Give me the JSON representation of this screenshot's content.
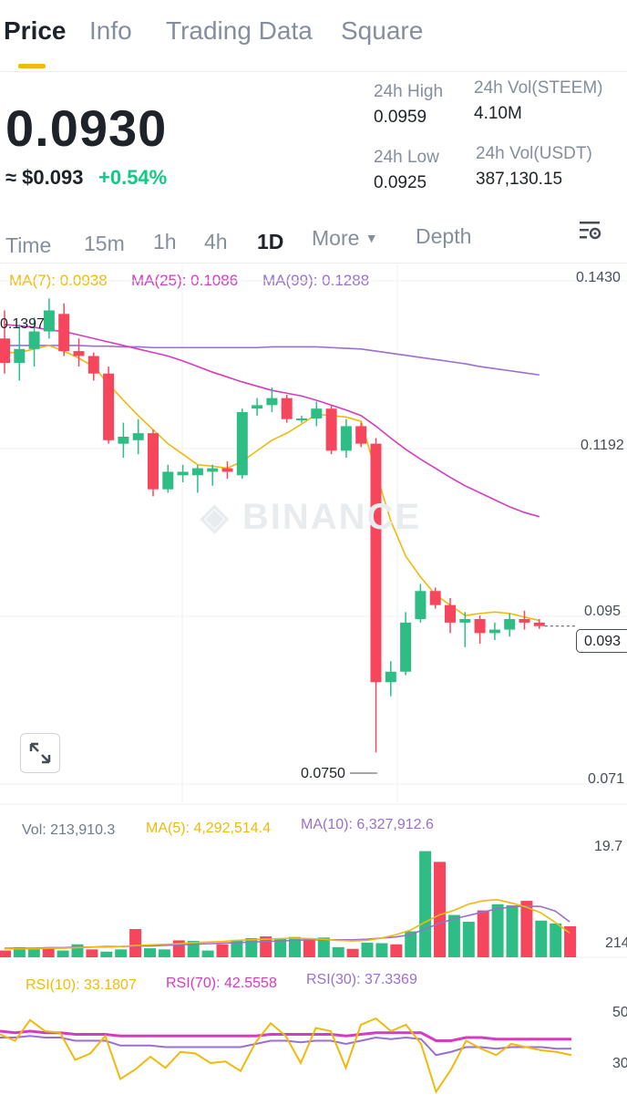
{
  "tabs": [
    "Price",
    "Info",
    "Trading Data",
    "Square"
  ],
  "price": {
    "last": "0.0930",
    "usd": "≈ $0.093",
    "change": "+0.54%"
  },
  "stats": {
    "high_label": "24h High",
    "high_value": "0.0959",
    "low_label": "24h Low",
    "low_value": "0.0925",
    "vol_base_label": "24h Vol(STEEM)",
    "vol_base_value": "4.10M",
    "vol_quote_label": "24h Vol(USDT)",
    "vol_quote_value": "387,130.15"
  },
  "timeframes": [
    "Time",
    "15m",
    "1h",
    "4h",
    "1D",
    "More",
    "Depth"
  ],
  "active_timeframe": "1D",
  "ma_legend": {
    "ma7": "MA(7): 0.0938",
    "ma25": "MA(25): 0.1086",
    "ma99": "MA(99): 0.1288"
  },
  "price_axis": [
    "0.1430",
    "0.1192",
    "0.095",
    "0.071"
  ],
  "current_price_tag": "0.093",
  "marker_high": "0.1397",
  "marker_low": "0.0750",
  "watermark": "BINANCE",
  "volume_legend": {
    "vol": "Vol: 213,910.3",
    "ma5": "MA(5): 4,292,514.4",
    "ma10": "MA(10): 6,327,912.6"
  },
  "volume_axis": [
    "19.7",
    "214"
  ],
  "rsi_legend": {
    "rsi10": "RSI(10): 33.1807",
    "rsi70": "RSI(70): 42.5558",
    "rsi30": "RSI(30): 37.3369"
  },
  "rsi_axis": [
    "50",
    "30"
  ],
  "colors": {
    "up": "#2ebd85",
    "down": "#f6465d",
    "ma7": "#f0b90b",
    "ma25": "#d63bc1",
    "ma99": "#9a6fcf",
    "accent": "#f0b90b"
  },
  "chart_data": {
    "type": "candlestick",
    "candles": [
      {
        "o": 0.134,
        "h": 0.138,
        "l": 0.129,
        "c": 0.1305
      },
      {
        "o": 0.1305,
        "h": 0.136,
        "l": 0.128,
        "c": 0.1325
      },
      {
        "o": 0.1325,
        "h": 0.137,
        "l": 0.13,
        "c": 0.135
      },
      {
        "o": 0.135,
        "h": 0.1397,
        "l": 0.134,
        "c": 0.138
      },
      {
        "o": 0.1375,
        "h": 0.139,
        "l": 0.1315,
        "c": 0.1322
      },
      {
        "o": 0.1322,
        "h": 0.134,
        "l": 0.13,
        "c": 0.1315
      },
      {
        "o": 0.1315,
        "h": 0.132,
        "l": 0.128,
        "c": 0.129
      },
      {
        "o": 0.129,
        "h": 0.13,
        "l": 0.119,
        "c": 0.1195
      },
      {
        "o": 0.119,
        "h": 0.122,
        "l": 0.117,
        "c": 0.12
      },
      {
        "o": 0.1195,
        "h": 0.1225,
        "l": 0.1175,
        "c": 0.1205
      },
      {
        "o": 0.1205,
        "h": 0.121,
        "l": 0.1115,
        "c": 0.1125
      },
      {
        "o": 0.1125,
        "h": 0.116,
        "l": 0.112,
        "c": 0.115
      },
      {
        "o": 0.1145,
        "h": 0.116,
        "l": 0.1135,
        "c": 0.115
      },
      {
        "o": 0.1145,
        "h": 0.116,
        "l": 0.112,
        "c": 0.1155
      },
      {
        "o": 0.115,
        "h": 0.116,
        "l": 0.113,
        "c": 0.1155
      },
      {
        "o": 0.1155,
        "h": 0.1165,
        "l": 0.114,
        "c": 0.115
      },
      {
        "o": 0.1145,
        "h": 0.124,
        "l": 0.114,
        "c": 0.1235
      },
      {
        "o": 0.124,
        "h": 0.1255,
        "l": 0.123,
        "c": 0.1245
      },
      {
        "o": 0.1245,
        "h": 0.127,
        "l": 0.1235,
        "c": 0.1255
      },
      {
        "o": 0.1255,
        "h": 0.126,
        "l": 0.122,
        "c": 0.1225
      },
      {
        "o": 0.1225,
        "h": 0.123,
        "l": 0.122,
        "c": 0.1226
      },
      {
        "o": 0.1226,
        "h": 0.125,
        "l": 0.1215,
        "c": 0.124
      },
      {
        "o": 0.124,
        "h": 0.1245,
        "l": 0.1175,
        "c": 0.118
      },
      {
        "o": 0.118,
        "h": 0.1225,
        "l": 0.117,
        "c": 0.1215
      },
      {
        "o": 0.1215,
        "h": 0.122,
        "l": 0.1185,
        "c": 0.119
      },
      {
        "o": 0.119,
        "h": 0.1198,
        "l": 0.075,
        "c": 0.085
      },
      {
        "o": 0.085,
        "h": 0.088,
        "l": 0.083,
        "c": 0.0865
      },
      {
        "o": 0.0865,
        "h": 0.095,
        "l": 0.086,
        "c": 0.0935
      },
      {
        "o": 0.094,
        "h": 0.099,
        "l": 0.0935,
        "c": 0.098
      },
      {
        "o": 0.098,
        "h": 0.0985,
        "l": 0.0955,
        "c": 0.096
      },
      {
        "o": 0.096,
        "h": 0.097,
        "l": 0.092,
        "c": 0.0935
      },
      {
        "o": 0.0935,
        "h": 0.095,
        "l": 0.09,
        "c": 0.094
      },
      {
        "o": 0.094,
        "h": 0.0945,
        "l": 0.0905,
        "c": 0.092
      },
      {
        "o": 0.092,
        "h": 0.0935,
        "l": 0.091,
        "c": 0.0925
      },
      {
        "o": 0.0925,
        "h": 0.0948,
        "l": 0.0915,
        "c": 0.094
      },
      {
        "o": 0.094,
        "h": 0.0952,
        "l": 0.0925,
        "c": 0.0935
      },
      {
        "o": 0.0935,
        "h": 0.094,
        "l": 0.0926,
        "c": 0.093
      }
    ],
    "ma7": [
      0.132,
      0.132,
      0.1325,
      0.133,
      0.1322,
      0.1312,
      0.13,
      0.1275,
      0.1252,
      0.123,
      0.121,
      0.119,
      0.1175,
      0.116,
      0.1158,
      0.1155,
      0.1165,
      0.118,
      0.1195,
      0.1205,
      0.1218,
      0.1232,
      0.123,
      0.1228,
      0.1222,
      0.115,
      0.108,
      0.103,
      0.1,
      0.0975,
      0.096,
      0.0945,
      0.0948,
      0.095,
      0.0948,
      0.0943,
      0.0938
    ],
    "ma25": [
      0.136,
      0.1358,
      0.1356,
      0.1352,
      0.135,
      0.1345,
      0.134,
      0.1335,
      0.133,
      0.1325,
      0.132,
      0.1315,
      0.1308,
      0.13,
      0.1292,
      0.1285,
      0.1278,
      0.1272,
      0.1266,
      0.1262,
      0.1258,
      0.1252,
      0.1245,
      0.1238,
      0.123,
      0.1215,
      0.1198,
      0.1182,
      0.1168,
      0.1155,
      0.1142,
      0.113,
      0.112,
      0.111,
      0.11,
      0.1092,
      0.1086
    ],
    "ma99": [
      0.133,
      0.133,
      0.133,
      0.133,
      0.133,
      0.133,
      0.1329,
      0.1329,
      0.1328,
      0.1328,
      0.1327,
      0.1327,
      0.1327,
      0.1327,
      0.1327,
      0.1327,
      0.1327,
      0.1327,
      0.1328,
      0.1328,
      0.1328,
      0.1328,
      0.1327,
      0.1326,
      0.1325,
      0.1322,
      0.1319,
      0.1316,
      0.1313,
      0.131,
      0.1307,
      0.1304,
      0.13,
      0.1297,
      0.1294,
      0.1291,
      0.1288
    ],
    "volume": [
      1.2,
      1.8,
      1.6,
      1.6,
      1.2,
      2.3,
      1.4,
      1.0,
      1.4,
      5.0,
      1.6,
      1.4,
      3.0,
      2.9,
      1.2,
      2.3,
      3.0,
      3.4,
      3.7,
      3.4,
      3.6,
      3.4,
      3.5,
      1.8,
      1.5,
      2.6,
      2.5,
      2.3,
      4.6,
      18.8,
      16.9,
      7.5,
      6.3,
      8.3,
      9.4,
      9.2,
      10.0,
      6.5,
      6.0,
      5.5
    ],
    "volume_ma5": [
      1.5,
      1.5,
      1.5,
      1.6,
      1.6,
      1.7,
      1.8,
      1.8,
      1.9,
      2.1,
      2.2,
      2.3,
      2.4,
      2.6,
      2.7,
      2.8,
      3.0,
      3.1,
      3.2,
      3.3,
      3.4,
      3.3,
      3.2,
      3.0,
      2.9,
      3.0,
      3.4,
      4.0,
      4.8,
      6.2,
      7.5,
      8.3,
      9.4,
      10.0,
      10.2,
      9.6,
      8.9,
      7.9,
      6.2,
      4.3
    ],
    "volume_ma10": [
      1.6,
      1.6,
      1.6,
      1.7,
      1.7,
      1.8,
      1.8,
      1.9,
      1.9,
      2.0,
      2.0,
      2.1,
      2.2,
      2.3,
      2.4,
      2.5,
      2.6,
      2.7,
      2.8,
      2.9,
      3.0,
      3.1,
      3.1,
      3.1,
      3.1,
      3.2,
      3.4,
      3.6,
      4.0,
      5.0,
      6.0,
      6.8,
      7.4,
      8.0,
      8.6,
      8.9,
      9.1,
      9.0,
      8.2,
      6.3
    ],
    "rsi10": [
      46,
      42,
      55,
      48,
      47,
      30,
      34,
      45,
      18,
      24,
      32,
      25,
      35,
      34,
      28,
      29,
      23,
      41,
      53,
      45,
      28,
      50,
      48,
      25,
      52,
      56,
      48,
      52,
      40,
      10,
      24,
      42,
      37,
      33,
      40,
      38,
      36,
      35,
      33
    ],
    "rsi70": [
      48,
      47,
      48,
      47,
      47,
      46,
      46,
      46,
      45,
      45,
      45,
      45,
      45,
      45,
      45,
      45,
      45,
      45,
      46,
      46,
      46,
      46,
      46,
      45,
      46,
      47,
      47,
      47,
      47,
      42,
      42,
      44,
      44,
      43,
      43,
      43,
      43,
      43,
      43
    ],
    "rsi30": [
      44,
      44,
      45,
      44,
      44,
      42,
      42,
      42,
      39,
      39,
      39,
      38,
      38,
      38,
      38,
      38,
      38,
      40,
      42,
      42,
      41,
      42,
      42,
      40,
      42,
      44,
      43,
      44,
      43,
      33,
      35,
      38,
      38,
      37,
      38,
      38,
      38,
      37,
      37
    ]
  }
}
